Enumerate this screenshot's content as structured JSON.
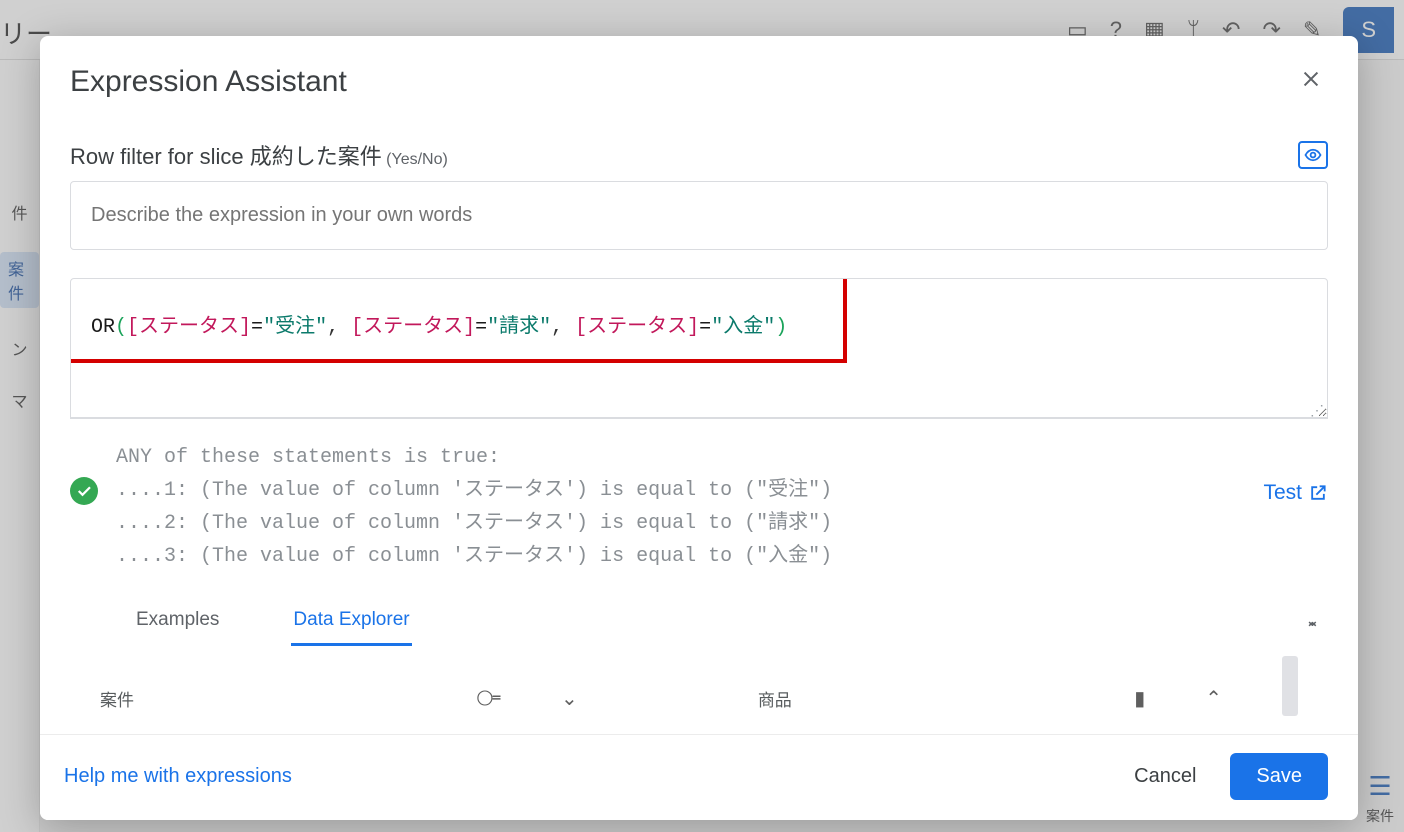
{
  "background": {
    "title_fragment": "リー",
    "save_button": "S",
    "sidebar_items": [
      "件",
      "案件",
      "ン",
      "マ"
    ],
    "sidebar_active_index": 1,
    "rightbar_label": "案件"
  },
  "modal": {
    "title": "Expression Assistant",
    "subheader_prefix": "Row filter for slice ",
    "subheader_slice": "成約した案件",
    "subheader_suffix": " (Yes/No)",
    "description_placeholder": "Describe the expression in your own words",
    "expression": {
      "fn": "OR",
      "conds": [
        {
          "column": "ステータス",
          "value": "受注"
        },
        {
          "column": "ステータス",
          "value": "請求"
        },
        {
          "column": "ステータス",
          "value": "入金"
        }
      ]
    },
    "validation": {
      "header": "ANY of these statements is true:",
      "lines": [
        "....1: (The value of column 'ステータス') is equal to (\"受注\")",
        "....2: (The value of column 'ステータス') is equal to (\"請求\")",
        "....3: (The value of column 'ステータス') is equal to (\"入金\")"
      ]
    },
    "test_label": "Test",
    "tabs": {
      "examples": "Examples",
      "data_explorer": "Data Explorer",
      "active": "data_explorer"
    },
    "explorer": {
      "left_label": "案件",
      "right_label": "商品"
    },
    "footer": {
      "help": "Help me with expressions",
      "cancel": "Cancel",
      "save": "Save"
    }
  }
}
